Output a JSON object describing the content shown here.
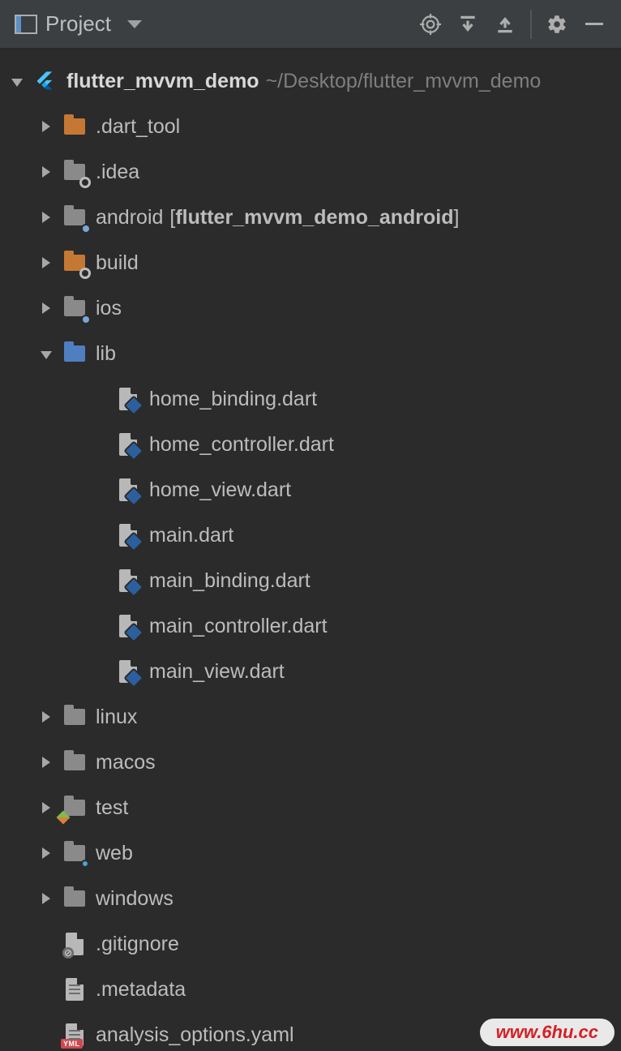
{
  "toolbar": {
    "title": "Project"
  },
  "root": {
    "name": "flutter_mvvm_demo",
    "path": "~/Desktop/flutter_mvvm_demo"
  },
  "tree": {
    "dart_tool": ".dart_tool",
    "idea": ".idea",
    "android_prefix": "android",
    "android_module": "flutter_mvvm_demo_android",
    "build": "build",
    "ios": "ios",
    "lib": "lib",
    "lib_files": {
      "f0": "home_binding.dart",
      "f1": "home_controller.dart",
      "f2": "home_view.dart",
      "f3": "main.dart",
      "f4": "main_binding.dart",
      "f5": "main_controller.dart",
      "f6": "main_view.dart"
    },
    "linux": "linux",
    "macos": "macos",
    "test": "test",
    "web": "web",
    "windows": "windows",
    "gitignore": ".gitignore",
    "metadata": ".metadata",
    "analysis": "analysis_options.yaml"
  },
  "watermark": "www.6hu.cc"
}
